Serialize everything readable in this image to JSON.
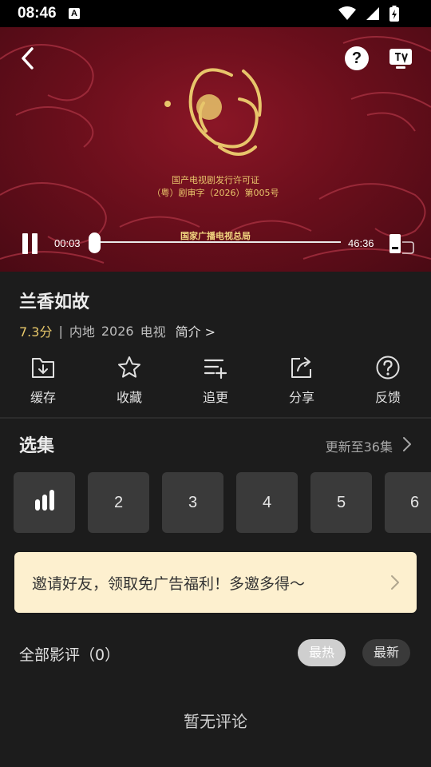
{
  "status_bar": {
    "time": "08:46",
    "indicator": "A"
  },
  "player": {
    "license_line1": "国产电视剧发行许可证",
    "license_line2": "（粤）剧审字（2026）第005号",
    "authority": "国家广播电视总局",
    "current_time": "00:03",
    "total_time": "46:36",
    "progress": 0.001,
    "help_label": "?"
  },
  "show": {
    "title": "兰香如故",
    "score": "7.3分",
    "separator": "|",
    "region": "内地",
    "year": "2026",
    "category": "电视",
    "intro": "简介 >"
  },
  "actions": [
    {
      "label": "缓存",
      "icon": "download-icon"
    },
    {
      "label": "收藏",
      "icon": "star-icon"
    },
    {
      "label": "追更",
      "icon": "playlist-add-icon"
    },
    {
      "label": "分享",
      "icon": "share-icon"
    },
    {
      "label": "反馈",
      "icon": "help-circle-icon"
    }
  ],
  "episodes": {
    "title": "选集",
    "update": "更新至36集",
    "items": [
      "1",
      "2",
      "3",
      "4",
      "5",
      "6"
    ],
    "current": "1"
  },
  "invite": {
    "text": "邀请好友，领取免广告福利！多邀多得～"
  },
  "reviews": {
    "title": "全部影评（0）",
    "sort_hot": "最热",
    "sort_new": "最新",
    "empty": "暂无评论"
  },
  "colors": {
    "score": "#e8c86a",
    "banner": "#fdf0cf",
    "background": "#1c1c1c",
    "player_red": "#7a1220"
  }
}
